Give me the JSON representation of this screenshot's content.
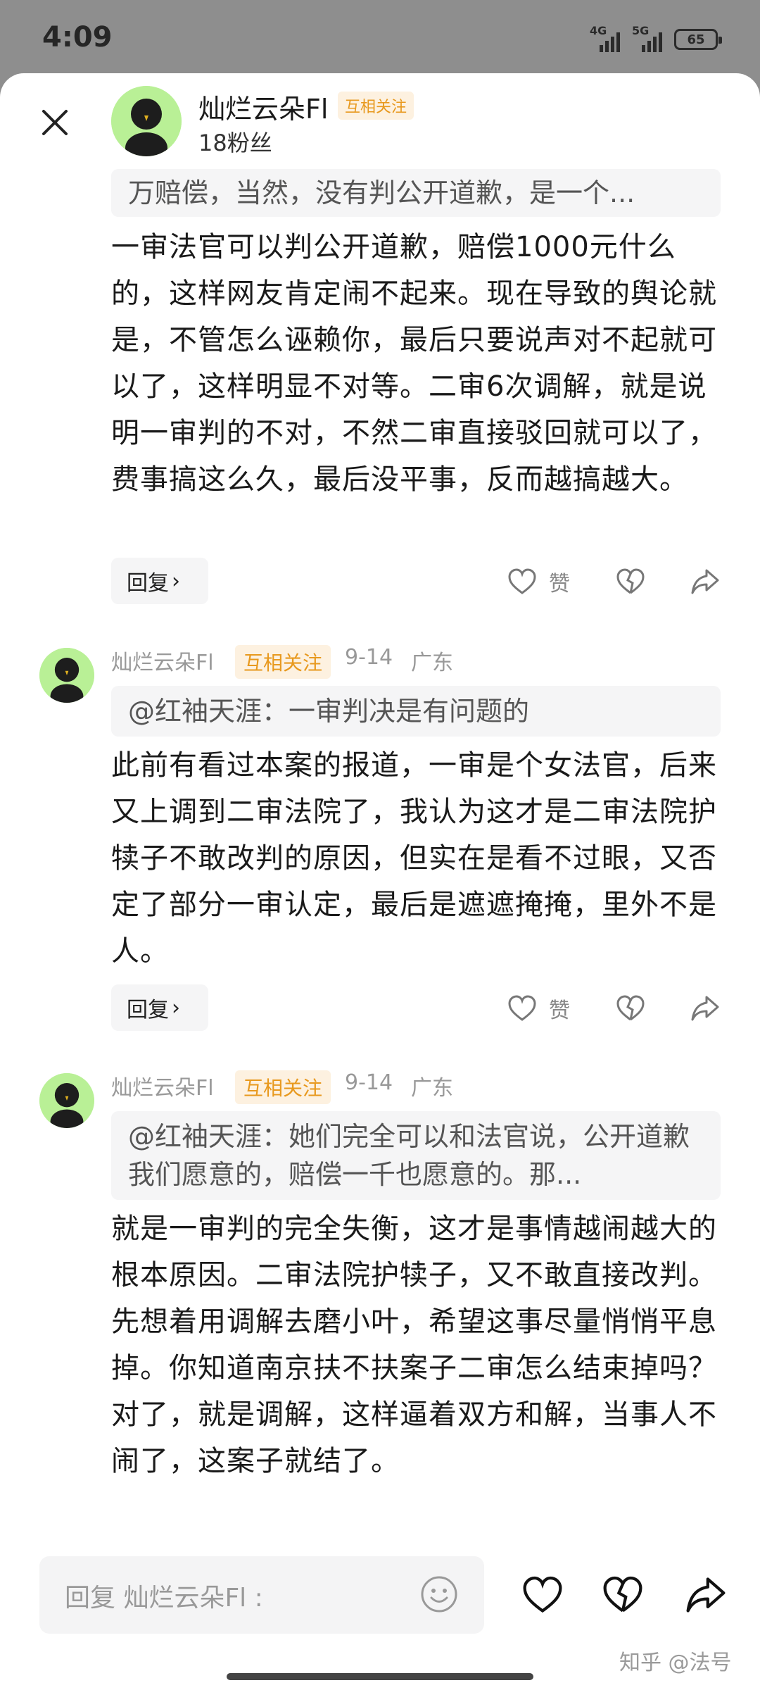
{
  "status_bar": {
    "time": "4:09",
    "network1": "4G",
    "network2": "5G",
    "battery": "65"
  },
  "header": {
    "username": "灿烂云朵Fl",
    "badge": "互相关注",
    "fans": "18粉丝"
  },
  "main_comment": {
    "quote": "万赔偿，当然，没有判公开道歉，是一个...",
    "text": "一审法官可以判公开道歉，赔偿1000元什么的，这样网友肯定闹不起来。现在导致的舆论就是，不管怎么诬赖你，最后只要说声对不起就可以了，这样明显不对等。二审6次调解，就是说明一审判的不对，不然二审直接驳回就可以了，费事搞这么久，最后没平事，反而越搞越大。",
    "reply_label": "回复",
    "like_label": "赞"
  },
  "comments": [
    {
      "username": "灿烂云朵Fl",
      "badge": "互相关注",
      "date": "9-14",
      "location": "广东",
      "quote": "@红袖天涯：一审判决是有问题的",
      "text": "此前有看过本案的报道，一审是个女法官，后来又上调到二审法院了，我认为这才是二审法院护犊子不敢改判的原因，但实在是看不过眼，又否定了部分一审认定，最后是遮遮掩掩，里外不是人。",
      "reply_label": "回复",
      "like_label": "赞"
    },
    {
      "username": "灿烂云朵Fl",
      "badge": "互相关注",
      "date": "9-14",
      "location": "广东",
      "quote": "@红袖天涯：她们完全可以和法官说，公开道歉我们愿意的，赔偿一千也愿意的。那...",
      "text": "就是一审判的完全失衡，这才是事情越闹越大的根本原因。二审法院护犊子，又不敢直接改判。先想着用调解去磨小叶，希望这事尽量悄悄平息掉。你知道南京扶不扶案子二审怎么结束掉吗？对了，就是调解，这样逼着双方和解，当事人不闹了，这案子就结了。"
    }
  ],
  "bottom_bar": {
    "placeholder": "回复 灿烂云朵Fl :",
    "watermark": "知乎 @法号"
  },
  "icons": {
    "close": "close-icon",
    "like": "heart-icon",
    "dislike": "broken-heart-icon",
    "share": "share-icon",
    "emoji": "emoji-icon"
  }
}
